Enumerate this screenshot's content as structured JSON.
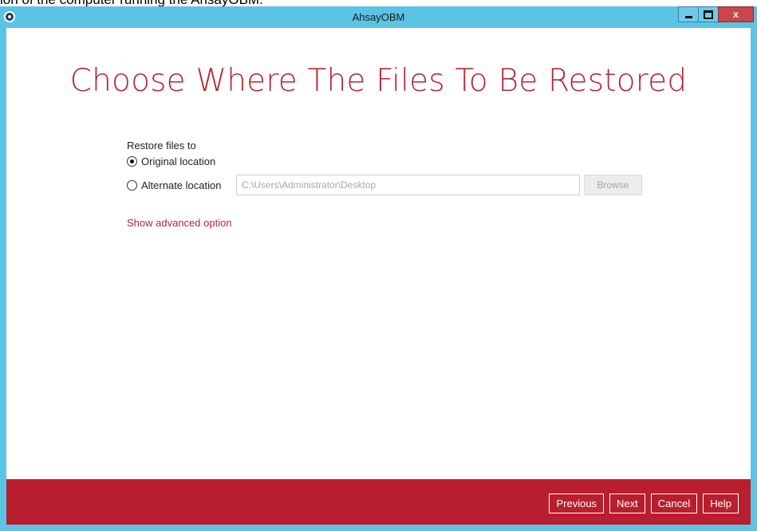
{
  "document_strip_text": "ion of the computer running the AhsayOBM.",
  "window": {
    "title": "AhsayOBM"
  },
  "page": {
    "heading": "Choose Where The Files To Be Restored"
  },
  "restore": {
    "group_label": "Restore files to",
    "options": [
      {
        "label": "Original location",
        "selected": true
      },
      {
        "label": "Alternate location",
        "selected": false
      }
    ],
    "alternate_path_placeholder": "C:\\Users\\Administrator\\Desktop",
    "browse_label": "Browse",
    "advanced_link": "Show advanced option"
  },
  "footer": {
    "buttons": [
      "Previous",
      "Next",
      "Cancel",
      "Help"
    ]
  },
  "colors": {
    "accent": "#b62733",
    "footer": "#b81e2d",
    "titlebar": "#5bc4e5"
  },
  "icons": {
    "app": "ahsay-app-icon",
    "minimize": "minimize-icon",
    "maximize": "maximize-icon",
    "close": "close-icon"
  }
}
